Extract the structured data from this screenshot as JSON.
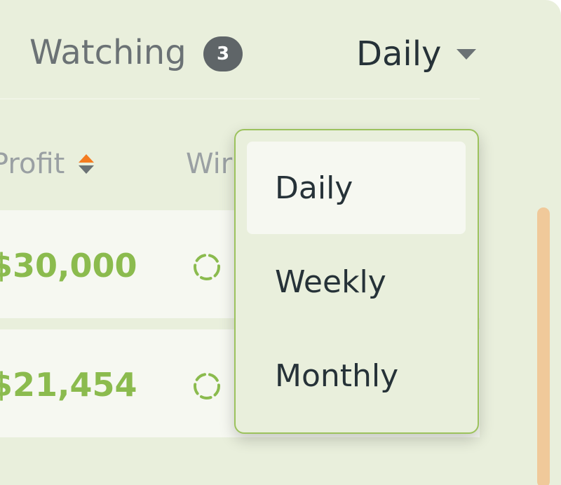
{
  "header": {
    "title": "Watching",
    "count": "3",
    "period": "Daily"
  },
  "columns": {
    "profit": "Profit",
    "win": "Wir"
  },
  "rows": [
    {
      "profit": "$30,000"
    },
    {
      "profit": "$21,454"
    }
  ],
  "dropdown": {
    "options": [
      {
        "label": "Daily",
        "selected": true
      },
      {
        "label": "Weekly",
        "selected": false
      },
      {
        "label": "Monthly",
        "selected": false
      }
    ]
  },
  "colors": {
    "accent_green": "#8bbb4e",
    "sort_active": "#f47c20",
    "scrollbar": "#f0c99a"
  },
  "icons": {
    "sort": "sort-icon",
    "spinner": "loading-spinner-icon",
    "caret": "caret-down-icon"
  }
}
